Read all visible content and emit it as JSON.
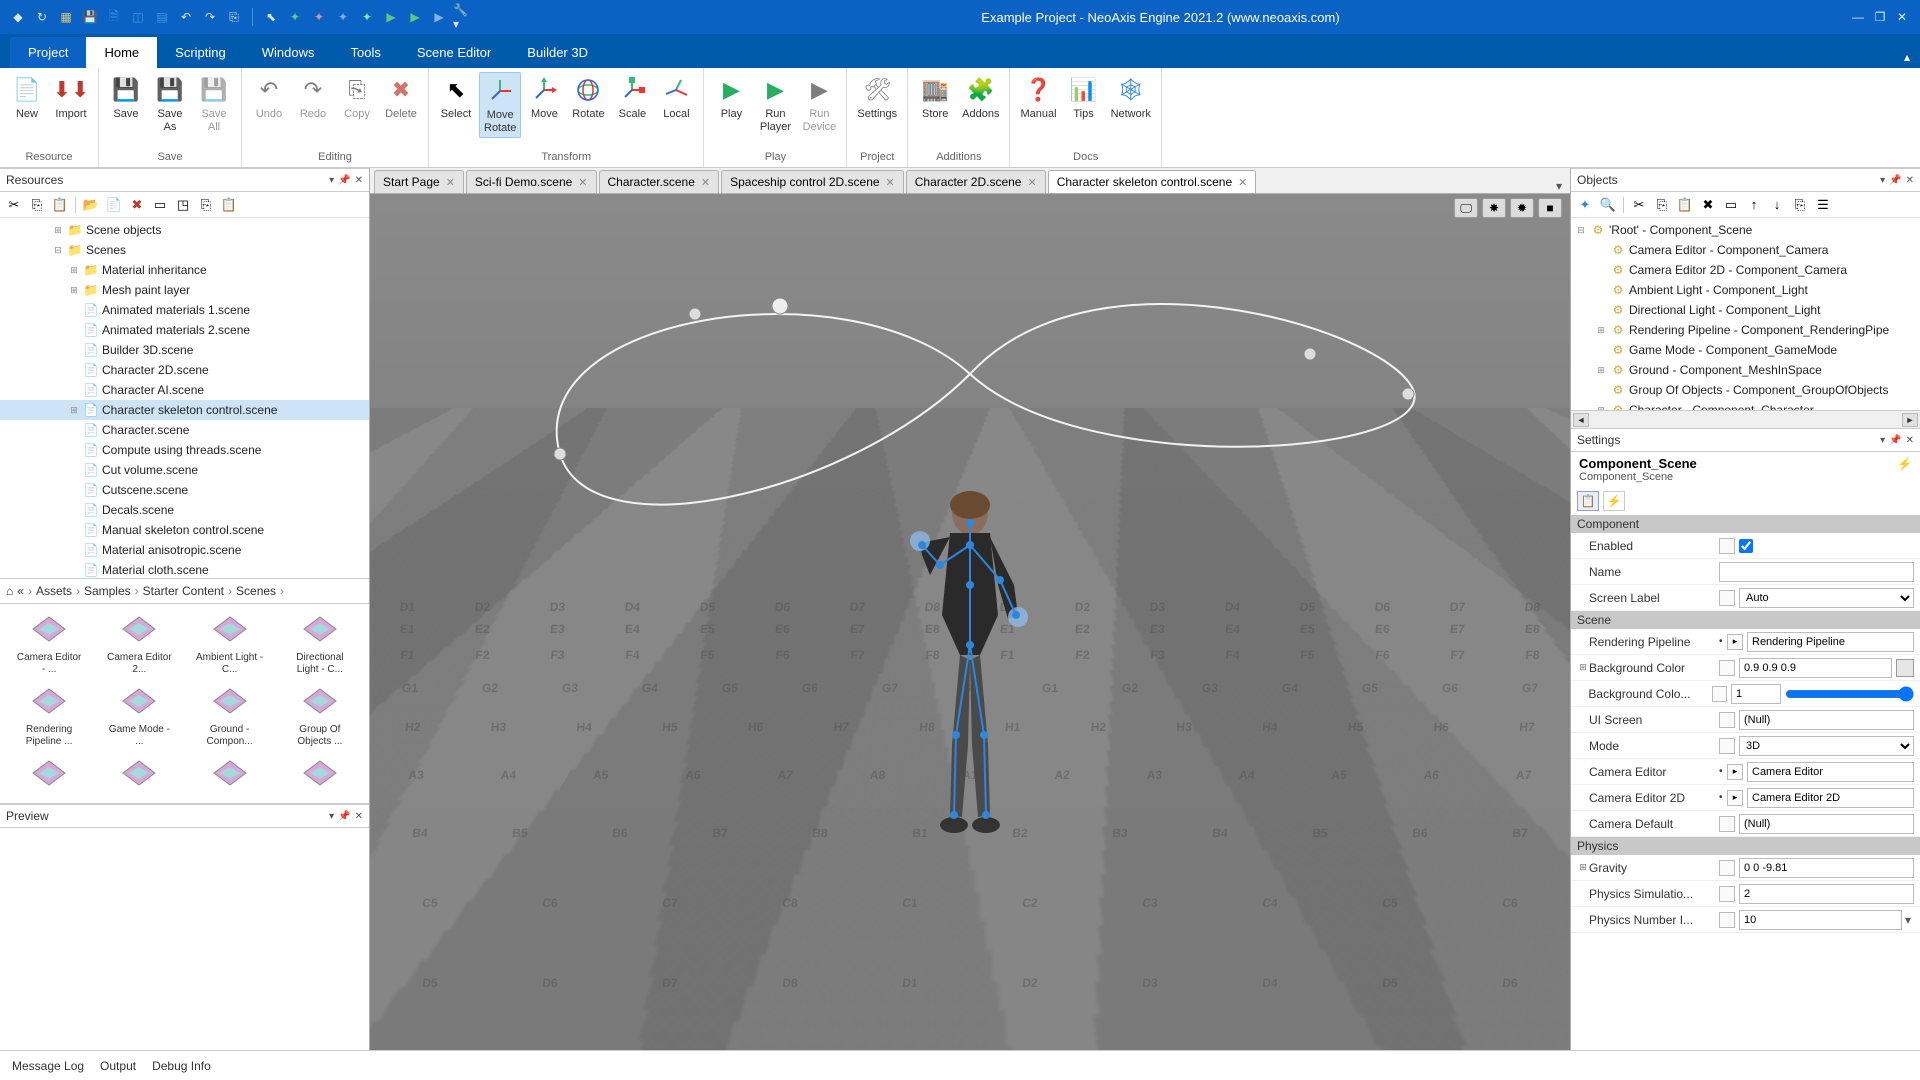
{
  "title": "Example Project - NeoAxis Engine 2021.2 (www.neoaxis.com)",
  "menu": {
    "project": "Project",
    "home": "Home",
    "scripting": "Scripting",
    "windows": "Windows",
    "tools": "Tools",
    "scene_editor": "Scene Editor",
    "builder_3d": "Builder 3D"
  },
  "ribbon": {
    "resource": {
      "label": "Resource",
      "new": "New",
      "import": "Import"
    },
    "save": {
      "label": "Save",
      "save": "Save",
      "save_as": "Save\nAs",
      "save_all": "Save\nAll"
    },
    "editing": {
      "label": "Editing",
      "undo": "Undo",
      "redo": "Redo",
      "copy": "Copy",
      "delete": "Delete"
    },
    "transform": {
      "label": "Transform",
      "select": "Select",
      "move_rotate": "Move\nRotate",
      "move": "Move",
      "rotate": "Rotate",
      "scale": "Scale",
      "local": "Local"
    },
    "play": {
      "label": "Play",
      "play": "Play",
      "run_player": "Run\nPlayer",
      "run_device": "Run\nDevice"
    },
    "project": {
      "label": "Project",
      "settings": "Settings"
    },
    "additions": {
      "label": "Additions",
      "store": "Store",
      "addons": "Addons"
    },
    "docs": {
      "label": "Docs",
      "manual": "Manual",
      "tips": "Tips",
      "network": "Network"
    }
  },
  "resources_panel": {
    "title": "Resources",
    "tree": [
      {
        "pad": 52,
        "toggle": "⊞",
        "icon": "folder",
        "label": "Scene objects"
      },
      {
        "pad": 52,
        "toggle": "⊟",
        "icon": "folder",
        "label": "Scenes"
      },
      {
        "pad": 68,
        "toggle": "⊞",
        "icon": "folder",
        "label": "Material inheritance"
      },
      {
        "pad": 68,
        "toggle": "⊞",
        "icon": "folder",
        "label": "Mesh paint layer"
      },
      {
        "pad": 68,
        "toggle": "",
        "icon": "file",
        "label": "Animated materials 1.scene"
      },
      {
        "pad": 68,
        "toggle": "",
        "icon": "file",
        "label": "Animated materials 2.scene"
      },
      {
        "pad": 68,
        "toggle": "",
        "icon": "file",
        "label": "Builder 3D.scene"
      },
      {
        "pad": 68,
        "toggle": "",
        "icon": "file",
        "label": "Character 2D.scene"
      },
      {
        "pad": 68,
        "toggle": "",
        "icon": "file",
        "label": "Character AI.scene"
      },
      {
        "pad": 68,
        "toggle": "⊞",
        "icon": "file",
        "label": "Character skeleton control.scene",
        "selected": true
      },
      {
        "pad": 68,
        "toggle": "",
        "icon": "file",
        "label": "Character.scene"
      },
      {
        "pad": 68,
        "toggle": "",
        "icon": "file",
        "label": "Compute using threads.scene"
      },
      {
        "pad": 68,
        "toggle": "",
        "icon": "file",
        "label": "Cut volume.scene"
      },
      {
        "pad": 68,
        "toggle": "",
        "icon": "file",
        "label": "Cutscene.scene"
      },
      {
        "pad": 68,
        "toggle": "",
        "icon": "file",
        "label": "Decals.scene"
      },
      {
        "pad": 68,
        "toggle": "",
        "icon": "file",
        "label": "Manual skeleton control.scene"
      },
      {
        "pad": 68,
        "toggle": "",
        "icon": "file",
        "label": "Material anisotropic.scene"
      },
      {
        "pad": 68,
        "toggle": "",
        "icon": "file",
        "label": "Material cloth.scene"
      }
    ],
    "breadcrumb": [
      "«",
      "Assets",
      "Samples",
      "Starter Content",
      "Scenes"
    ],
    "assets": [
      "Camera Editor - ...",
      "Camera Editor 2...",
      "Ambient Light - C...",
      "Directional Light - C...",
      "Rendering Pipeline ...",
      "Game Mode - ...",
      "Ground - Compon...",
      "Group Of Objects ..."
    ]
  },
  "preview_panel": {
    "title": "Preview"
  },
  "doc_tabs": [
    {
      "label": "Start Page",
      "close": true
    },
    {
      "label": "Sci-fi Demo.scene",
      "close": true
    },
    {
      "label": "Character.scene",
      "close": true
    },
    {
      "label": "Spaceship control 2D.scene",
      "close": true
    },
    {
      "label": "Character 2D.scene",
      "close": true
    },
    {
      "label": "Character skeleton control.scene",
      "close": true,
      "active": true
    }
  ],
  "objects_panel": {
    "title": "Objects",
    "tree": [
      {
        "pad": 4,
        "toggle": "⊟",
        "icon": "gear",
        "label": "'Root' - Component_Scene"
      },
      {
        "pad": 24,
        "toggle": "",
        "icon": "gear",
        "label": "Camera Editor - Component_Camera"
      },
      {
        "pad": 24,
        "toggle": "",
        "icon": "gear",
        "label": "Camera Editor 2D - Component_Camera"
      },
      {
        "pad": 24,
        "toggle": "",
        "icon": "gear",
        "label": "Ambient Light - Component_Light"
      },
      {
        "pad": 24,
        "toggle": "",
        "icon": "gear",
        "label": "Directional Light - Component_Light"
      },
      {
        "pad": 24,
        "toggle": "⊞",
        "icon": "gear",
        "label": "Rendering Pipeline - Component_RenderingPipe"
      },
      {
        "pad": 24,
        "toggle": "",
        "icon": "gear",
        "label": "Game Mode - Component_GameMode"
      },
      {
        "pad": 24,
        "toggle": "⊞",
        "icon": "gear",
        "label": "Ground - Component_MeshInSpace"
      },
      {
        "pad": 24,
        "toggle": "",
        "icon": "gear",
        "label": "Group Of Objects - Component_GroupOfObjects"
      },
      {
        "pad": 24,
        "toggle": "⊞",
        "icon": "gear",
        "label": "Character - Component_Character"
      }
    ]
  },
  "settings_panel": {
    "title": "Settings",
    "component_title": "Component_Scene",
    "component_sub": "Component_Scene",
    "sections": {
      "component": "Component",
      "scene": "Scene",
      "physics": "Physics"
    },
    "props": {
      "enabled": {
        "label": "Enabled",
        "value": true
      },
      "name": {
        "label": "Name",
        "value": ""
      },
      "screen_label": {
        "label": "Screen Label",
        "value": "Auto"
      },
      "rendering_pipeline": {
        "label": "Rendering Pipeline",
        "value": "Rendering Pipeline"
      },
      "background_color": {
        "label": "Background Color",
        "value": "0.9 0.9 0.9"
      },
      "background_color_env": {
        "label": "Background Colo...",
        "value": "1"
      },
      "ui_screen": {
        "label": "UI Screen",
        "value": "(Null)"
      },
      "mode": {
        "label": "Mode",
        "value": "3D"
      },
      "camera_editor": {
        "label": "Camera Editor",
        "value": "Camera Editor"
      },
      "camera_editor_2d": {
        "label": "Camera Editor 2D",
        "value": "Camera Editor 2D"
      },
      "camera_default": {
        "label": "Camera Default",
        "value": "(Null)"
      },
      "gravity": {
        "label": "Gravity",
        "value": "0 0 -9.81"
      },
      "physics_sim": {
        "label": "Physics Simulatio...",
        "value": "2"
      },
      "physics_num": {
        "label": "Physics Number I...",
        "value": "10"
      }
    }
  },
  "statusbar": {
    "message_log": "Message Log",
    "output": "Output",
    "debug_info": "Debug Info"
  }
}
